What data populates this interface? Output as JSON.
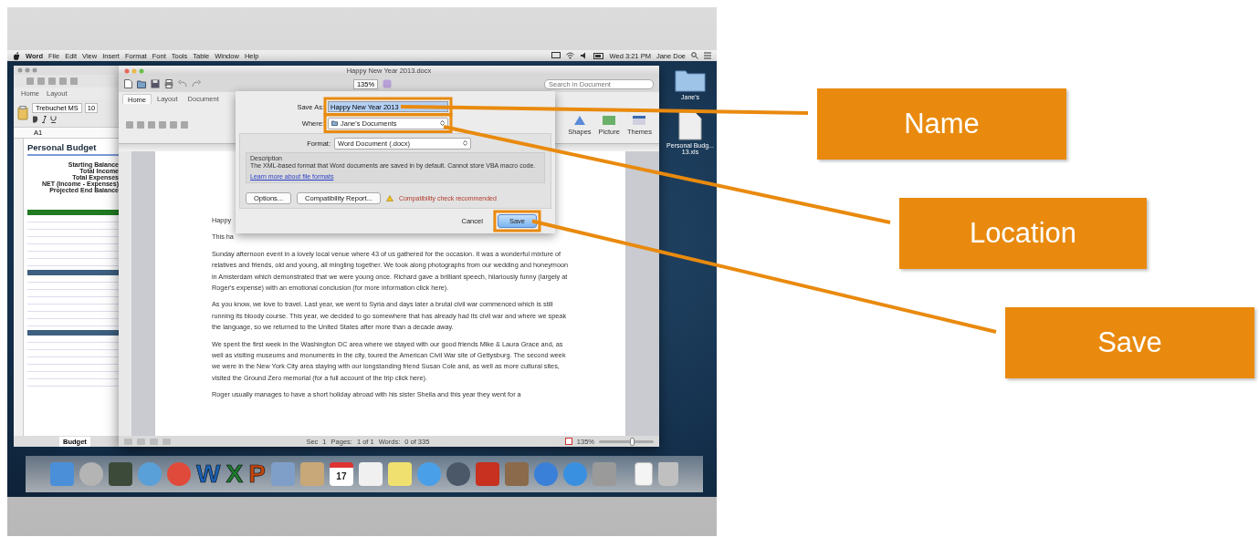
{
  "screen": {
    "menu_bar": {
      "items": [
        "Word",
        "File",
        "Edit",
        "View",
        "Insert",
        "Format",
        "Font",
        "Tools",
        "Table",
        "Window",
        "Help"
      ],
      "clock": "Wed 3:21 PM",
      "user": "Jane Doe"
    },
    "excel_window": {
      "ribbon_tabs": [
        "Home",
        "Layout"
      ],
      "font_name": "Trebuchet MS",
      "font_size": "10",
      "cell_ref": "A1",
      "sheet_title": "Personal Budget",
      "summary_labels": [
        "Starting Balance",
        "Total Income",
        "Total Expenses",
        "NET (Income - Expenses)",
        "Projected End Balance"
      ],
      "sections": [
        {
          "color": "#1f7a22"
        },
        {
          "color": "#3d5f80"
        },
        {
          "color": "#3d5f80"
        }
      ],
      "sheet_tab": "Budget"
    },
    "word_window": {
      "title": "Happy New Year 2013.docx",
      "toolbar_zoom": "135%",
      "search": {
        "placeholder": "Search in Document"
      },
      "ribbon_tabs": [
        {
          "label": "Home",
          "selected": true
        },
        {
          "label": "Layout",
          "selected": false
        },
        {
          "label": "Document",
          "selected": false
        }
      ],
      "ribbon_buttons": [
        "Shapes",
        "Picture",
        "Themes"
      ],
      "document": {
        "fragments": [
          "Happy",
          "This ha"
        ],
        "paragraphs": [
          "Sunday afternoon event in a lovely local venue where 43 of us gathered for the occasion. It was a wonderful mixture of relatives and friends, old and young, all mingling together. We took along photographs from our wedding and honeymoon in Amsterdam which demonstrated that we were young once. Richard gave a brilliant speech, hilariously funny (largely at Roger's expense) with an emotional conclusion (for more information click here).",
          "As you know, we love to travel. Last year, we went to Syria and days later a brutal civil war commenced which is still running its bloody course. This year, we decided to go somewhere that has already had its civil war and where we speak the language, so we returned to the United States after more than a decade away.",
          "We spent the first week in the Washington DC area where we stayed with our good friends Mike & Laura Grace and, as well as visiting museums and monuments in the city, toured the American Civil War site of Gettysburg. The second week we were in the New York City area staying with our longstanding friend Susan Cole and, as well as more cultural sites, visited the Ground Zero memorial (for a full account of the trip click here).",
          "Roger usually manages to have a short holiday abroad with his sister Sheila and this year they went for a"
        ]
      },
      "status_bar": [
        "Sec",
        "1",
        "Pages:",
        "1 of 1",
        "Words:",
        "0 of 335",
        "135%"
      ],
      "zoom_slider": {
        "level": 0.6
      }
    },
    "save_dialog": {
      "save_as_label": "Save As:",
      "file_name": "Happy New Year 2013",
      "where_label": "Where:",
      "location": "Jane's Documents",
      "format_label": "Format:",
      "format": "Word Document (.docx)",
      "description_label": "Description",
      "description": "The XML-based format that Word documents are saved in by default. Cannot store VBA macro code.",
      "learn_more": "Learn more about file formats",
      "buttons": [
        "Options...",
        "Compatibility Report..."
      ],
      "warning": "Compatibility check recommended",
      "cancel": "Cancel",
      "save": "Save"
    },
    "desktop_icons": [
      {
        "kind": "folder",
        "label": "Jane's"
      },
      {
        "kind": "document",
        "label": "Personal Budg... 13.xls"
      }
    ],
    "dock": [
      {
        "kind": "square",
        "color": "#4a8fd8"
      },
      {
        "kind": "circle",
        "color": "#b4b4b4"
      },
      {
        "kind": "square",
        "color": "#3c4a3a"
      },
      {
        "kind": "circle",
        "color": "#5aa0d8"
      },
      {
        "kind": "circle",
        "color": "#e04a3a"
      },
      {
        "kind": "letter",
        "color": "#1a5fb0",
        "glyph": "W"
      },
      {
        "kind": "letter",
        "color": "#1d7a2c",
        "glyph": "X"
      },
      {
        "kind": "letter",
        "color": "#c2460f",
        "glyph": "P"
      },
      {
        "kind": "square",
        "color": "#7f9fc8"
      },
      {
        "kind": "square",
        "color": "#c8a878"
      },
      {
        "kind": "calendar",
        "color": "#ffffff",
        "glyph": "17"
      },
      {
        "kind": "square",
        "color": "#f0f0f0"
      },
      {
        "kind": "square",
        "color": "#f0e070"
      },
      {
        "kind": "circle",
        "color": "#4aa0e8"
      },
      {
        "kind": "circle",
        "color": "#4a5868"
      },
      {
        "kind": "square",
        "color": "#c83020"
      },
      {
        "kind": "square",
        "color": "#8a6a4a"
      },
      {
        "kind": "circle",
        "color": "#3a80d8"
      },
      {
        "kind": "circle",
        "color": "#3a90e0"
      },
      {
        "kind": "square",
        "color": "#9a9a9a"
      },
      {
        "kind": "document",
        "color": "#f4f4f4"
      },
      {
        "kind": "trash",
        "color": "#c0c0c0"
      }
    ]
  },
  "callouts": [
    {
      "label": "Name"
    },
    {
      "label": "Location"
    },
    {
      "label": "Save"
    }
  ]
}
